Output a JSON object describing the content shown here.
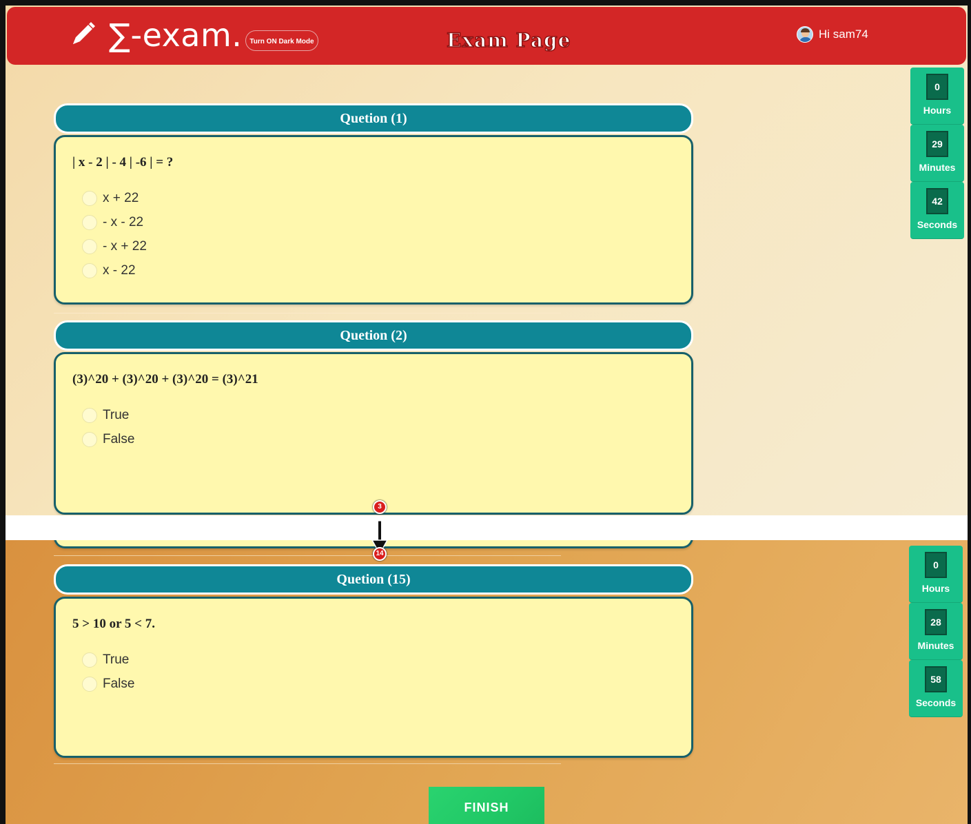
{
  "header": {
    "logo_text": "∑-exam.",
    "dark_mode_label": "Turn ON Dark Mode",
    "page_title": "Exam Page",
    "greeting": "Hi sam74"
  },
  "timer_top": {
    "hours": "0",
    "hours_label": "Hours",
    "minutes": "29",
    "minutes_label": "Minutes",
    "seconds": "42",
    "seconds_label": "Seconds"
  },
  "timer_bottom": {
    "hours": "0",
    "hours_label": "Hours",
    "minutes": "28",
    "minutes_label": "Minutes",
    "seconds": "58",
    "seconds_label": "Seconds"
  },
  "questions": [
    {
      "title": "Quetion (1)",
      "text": "| x - 2 | - 4 | -6 | = ?",
      "options": [
        "x + 22",
        "- x - 22",
        "- x + 22",
        "x - 22"
      ]
    },
    {
      "title": "Quetion (2)",
      "text": "(3)^20 + (3)^20 + (3)^20 = (3)^21",
      "options": [
        "True",
        "False"
      ]
    },
    {
      "title": "Quetion (15)",
      "text": "5 > 10 or 5 < 7.",
      "options": [
        "True",
        "False"
      ]
    }
  ],
  "markers": {
    "start": "3",
    "end": "14"
  },
  "finish_label": "FINISH",
  "colors": {
    "header": "#d32626",
    "question_header": "#0f8796",
    "card": "#fff8ae",
    "timer": "#19c08a",
    "finish": "#21c866"
  }
}
